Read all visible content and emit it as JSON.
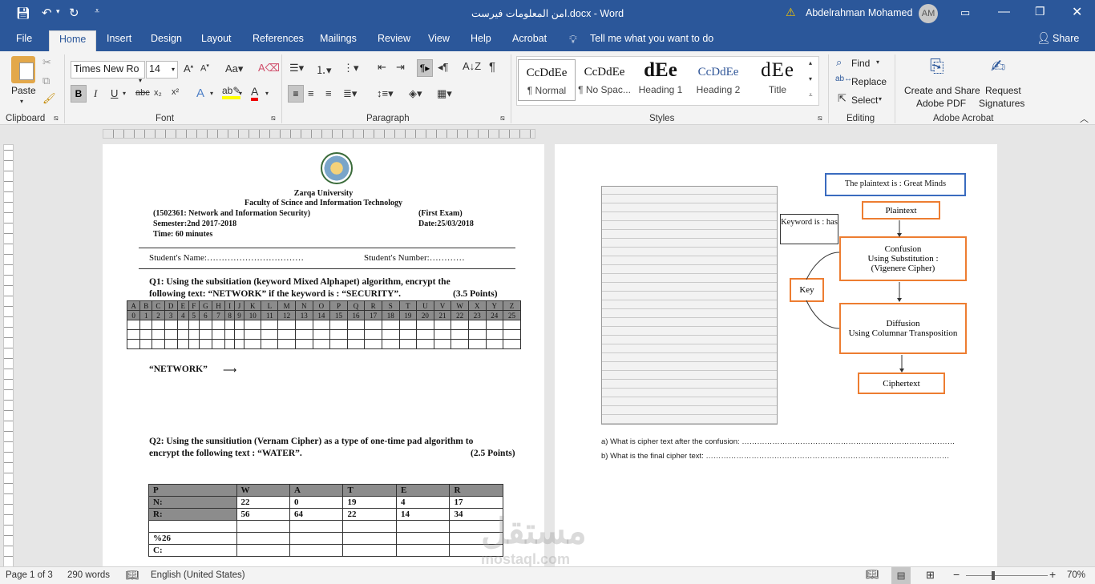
{
  "window": {
    "doc_title": "امن المعلومات فيرست.docx - Word",
    "user_name": "Abdelrahman Mohamed",
    "user_initials": "AM"
  },
  "tabs": [
    "File",
    "Home",
    "Insert",
    "Design",
    "Layout",
    "References",
    "Mailings",
    "Review",
    "View",
    "Help",
    "Acrobat"
  ],
  "tell_me": "Tell me what you want to do",
  "share": "Share",
  "clipboard": {
    "paste": "Paste",
    "group": "Clipboard"
  },
  "font": {
    "name": "Times New Ro",
    "size": "14",
    "group": "Font",
    "bold": "B",
    "italic": "I",
    "underline": "U",
    "strike": "abc",
    "sub": "x₂",
    "sup": "x²"
  },
  "paragraph": {
    "group": "Paragraph"
  },
  "styles": {
    "group": "Styles",
    "items": [
      {
        "preview": "CcDdEe",
        "label": "¶ Normal"
      },
      {
        "preview": "CcDdEe",
        "label": "¶ No Spac..."
      },
      {
        "preview": "dEe",
        "label": "Heading 1"
      },
      {
        "preview": "CcDdEe",
        "label": "Heading 2"
      },
      {
        "preview": "dEe",
        "label": "Title"
      }
    ]
  },
  "editing": {
    "find": "Find",
    "replace": "Replace",
    "select": "Select",
    "group": "Editing"
  },
  "acrobat": {
    "create": "Create and Share",
    "create2": "Adobe PDF",
    "request": "Request",
    "request2": "Signatures",
    "group": "Adobe Acrobat"
  },
  "page1": {
    "univ": "Zarqa University",
    "faculty": "Faculty of Scince and Information Technology",
    "course": "(1502361: Network and Information Security)",
    "exam": "(First  Exam)",
    "semester": "Semester:2nd 2017-2018",
    "date": "Date:25/03/2018",
    "time": "Time: 60 minutes",
    "student_name": "Student's Name:……………………………",
    "student_number": "Student's Number:…………",
    "q1_line1": "Q1: Using the subsitiation (keyword Mixed Alphapet) algorithm, encrypt the",
    "q1_line2": "following text: “NETWORK” if the keyword is : “SECURITY”.",
    "q1_points": "(3.5 Points)",
    "letters": [
      "A",
      "B",
      "C",
      "D",
      "E",
      "F",
      "G",
      "H",
      "I",
      "J",
      "K",
      "L",
      "M",
      "N",
      "O",
      "P",
      "Q",
      "R",
      "S",
      "T",
      "U",
      "V",
      "W",
      "X",
      "Y",
      "Z"
    ],
    "numbers": [
      "0",
      "1",
      "2",
      "3",
      "4",
      "5",
      "6",
      "7",
      "8",
      "9",
      "10",
      "11",
      "12",
      "13",
      "14",
      "15",
      "16",
      "17",
      "18",
      "19",
      "20",
      "21",
      "22",
      "23",
      "24",
      "25"
    ],
    "network": "“NETWORK”",
    "q2_line1": "Q2: Using the sunsitiution (Vernam Cipher) as a type of one-time pad algorithm to",
    "q2_line2": "encrypt the following text : “WATER”.",
    "q2_points": "(2.5 Points)",
    "vernam": [
      [
        "P",
        "W",
        "A",
        "T",
        "E",
        "R"
      ],
      [
        "N:",
        "22",
        "0",
        "19",
        "4",
        "17"
      ],
      [
        "R:",
        "56",
        "64",
        "22",
        "14",
        "34"
      ],
      [
        "",
        "",
        "",
        "",
        "",
        ""
      ],
      [
        "%26",
        "",
        "",
        "",
        "",
        ""
      ],
      [
        "C:",
        "",
        "",
        "",
        "",
        ""
      ]
    ]
  },
  "page2": {
    "plaintext_is": "The plaintext is : Great Minds",
    "keyword": "Keyword is : has",
    "plaintext": "Plaintext",
    "confusion1": "Confusion",
    "confusion2": "Using Substitution :",
    "confusion3": "(Vigenere Cipher)",
    "key": "Key",
    "diffusion1": "Diffusion",
    "diffusion2": "Using Columnar Transposition",
    "ciphertext": "Ciphertext",
    "qa": "a)   What is cipher text after the confusion: …………………………………………………………………………",
    "qb": "b)   What is the final cipher text: ……………………………………………………………………………………"
  },
  "status": {
    "page": "Page 1 of 3",
    "words": "290 words",
    "lang": "English (United States)",
    "zoom": "70%"
  },
  "watermark": "مستقل",
  "watermark_sub": "mostaql.com"
}
